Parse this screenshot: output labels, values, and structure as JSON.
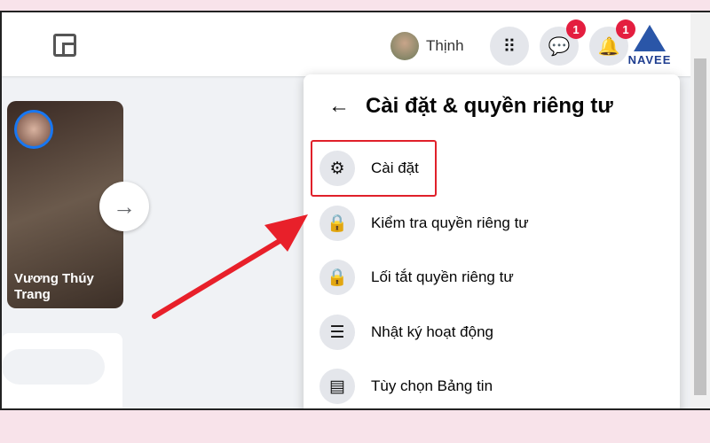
{
  "header": {
    "user_name": "Thịnh",
    "messenger_badge": "1",
    "notifications_badge": "1",
    "watermark": "NAVEE"
  },
  "story": {
    "name": "Vương Thúy Trang"
  },
  "panel": {
    "title": "Cài đặt & quyền riêng tư",
    "items": [
      {
        "label": "Cài đặt",
        "icon": "gear-icon"
      },
      {
        "label": "Kiểm tra quyền riêng tư",
        "icon": "lock-heart-icon"
      },
      {
        "label": "Lối tắt quyền riêng tư",
        "icon": "lock-icon"
      },
      {
        "label": "Nhật ký hoạt động",
        "icon": "list-icon"
      },
      {
        "label": "Tùy chọn Bảng tin",
        "icon": "feed-icon"
      }
    ]
  },
  "colors": {
    "highlight": "#e0202a",
    "accent": "#1877f2",
    "badge": "#e41e3f"
  }
}
